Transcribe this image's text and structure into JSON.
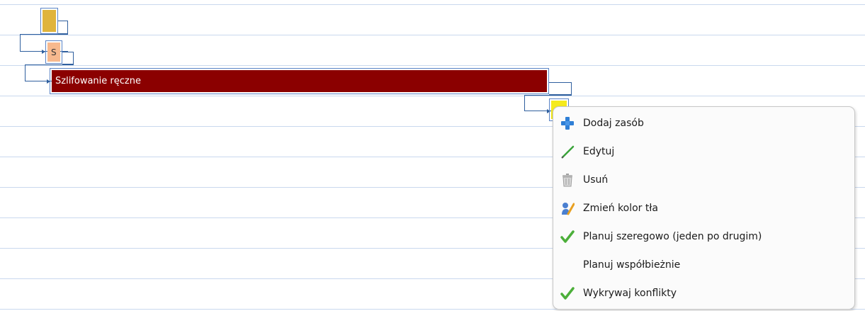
{
  "gantt": {
    "tasks": [
      {
        "id": "task-1",
        "label": "",
        "color": "#e0b43c"
      },
      {
        "id": "task-2",
        "label": "S",
        "color": "#f7b98e"
      },
      {
        "id": "task-3",
        "label": "Szlifowanie ręczne",
        "color": "#8b0000"
      },
      {
        "id": "task-4",
        "label": "",
        "color": "#f5ea1c"
      }
    ],
    "line_color": "#c9d8ee",
    "connector_color": "#2f5f9e"
  },
  "context_menu": {
    "items": [
      {
        "label": "Dodaj zasób",
        "icon": "plus-icon"
      },
      {
        "label": "Edytuj",
        "icon": "pencil-icon"
      },
      {
        "label": "Usuń",
        "icon": "trash-icon"
      },
      {
        "label": "Zmień kolor tła",
        "icon": "palette-icon"
      },
      {
        "label": "Planuj szeregowo (jeden po drugim)",
        "icon": "checkmark-icon",
        "checked": true
      },
      {
        "label": "Planuj współbieżnie",
        "icon": "",
        "checked": false
      },
      {
        "label": "Wykrywaj konflikty",
        "icon": "checkmark-icon",
        "checked": true
      }
    ]
  }
}
